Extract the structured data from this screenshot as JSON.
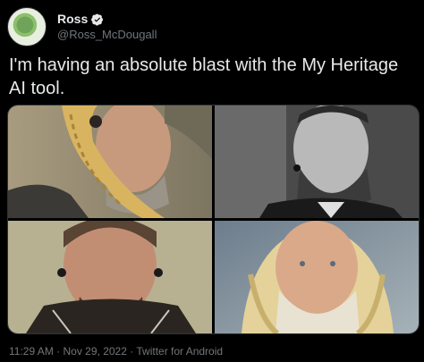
{
  "author": {
    "display_name": "Ross",
    "handle": "@Ross_McDougall",
    "avatar_icon": "avatar-frog-icon",
    "verified_icon": "verified-badge-icon"
  },
  "tweet": {
    "text": "I'm having an absolute blast with the My Heritage AI tool."
  },
  "media": {
    "photos": [
      {
        "name": "viking-braided-portrait"
      },
      {
        "name": "black-and-white-portrait"
      },
      {
        "name": "tattooed-warrior-portrait"
      },
      {
        "name": "painted-blond-viking-portrait"
      }
    ]
  },
  "meta": {
    "time": "11:29 AM",
    "separator": "·",
    "date": "Nov 29, 2022",
    "source": "Twitter for Android"
  },
  "colors": {
    "background": "#000000",
    "text": "#e7e9ea",
    "secondary": "#71767b",
    "verified": "#1d9bf0"
  }
}
